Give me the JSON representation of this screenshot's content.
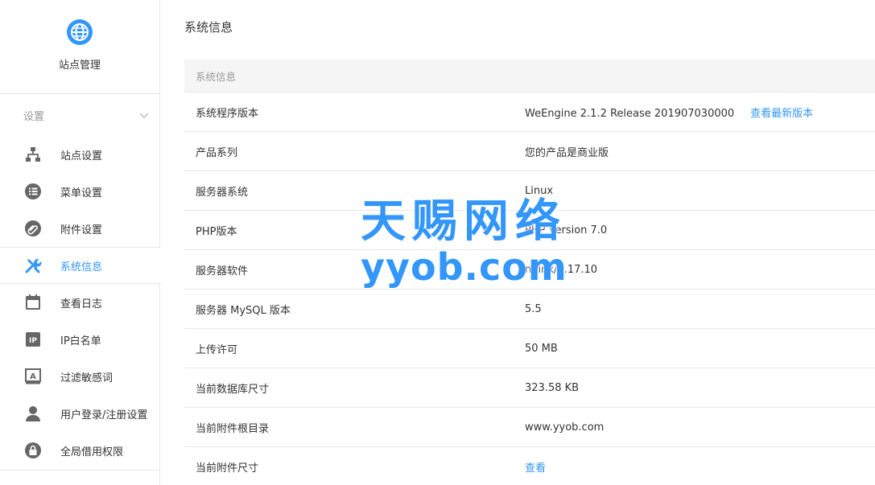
{
  "sidebar": {
    "site_title": "站点管理",
    "section_label": "设置",
    "items": [
      {
        "label": "站点设置",
        "icon": "sitemap-icon"
      },
      {
        "label": "菜单设置",
        "icon": "list-icon"
      },
      {
        "label": "附件设置",
        "icon": "paperclip-icon"
      },
      {
        "label": "系统信息",
        "icon": "tools-icon",
        "active": true
      },
      {
        "label": "查看日志",
        "icon": "calendar-icon"
      },
      {
        "label": "IP白名单",
        "icon": "ip-icon"
      },
      {
        "label": "过滤敏感词",
        "icon": "text-filter-icon"
      },
      {
        "label": "用户登录/注册设置",
        "icon": "user-icon"
      },
      {
        "label": "全局借用权限",
        "icon": "lock-icon"
      }
    ]
  },
  "main": {
    "page_title": "系统信息",
    "table_header": "系统信息",
    "rows": [
      {
        "key": "系统程序版本",
        "value": "WeEngine 2.1.2 Release 201907030000",
        "link": "查看最新版本"
      },
      {
        "key": "产品系列",
        "value": "您的产品是商业版"
      },
      {
        "key": "服务器系统",
        "value": "Linux"
      },
      {
        "key": "PHP版本",
        "value": "PHP Version 7.0"
      },
      {
        "key": "服务器软件",
        "value": "nginx/1.17.10"
      },
      {
        "key": "服务器 MySQL 版本",
        "value": "5.5"
      },
      {
        "key": "上传许可",
        "value": "50 MB"
      },
      {
        "key": "当前数据库尺寸",
        "value": "323.58 KB"
      },
      {
        "key": "当前附件根目录",
        "value": "www.yyob.com"
      },
      {
        "key": "当前附件尺寸",
        "value": "查看"
      }
    ]
  },
  "watermark": {
    "line1": "天赐网络",
    "line2": "yyob.com"
  },
  "colors": {
    "accent": "#3296fa",
    "icon_gray": "#666666",
    "border": "#e7e7eb",
    "header_bg": "#f5f5f5"
  }
}
